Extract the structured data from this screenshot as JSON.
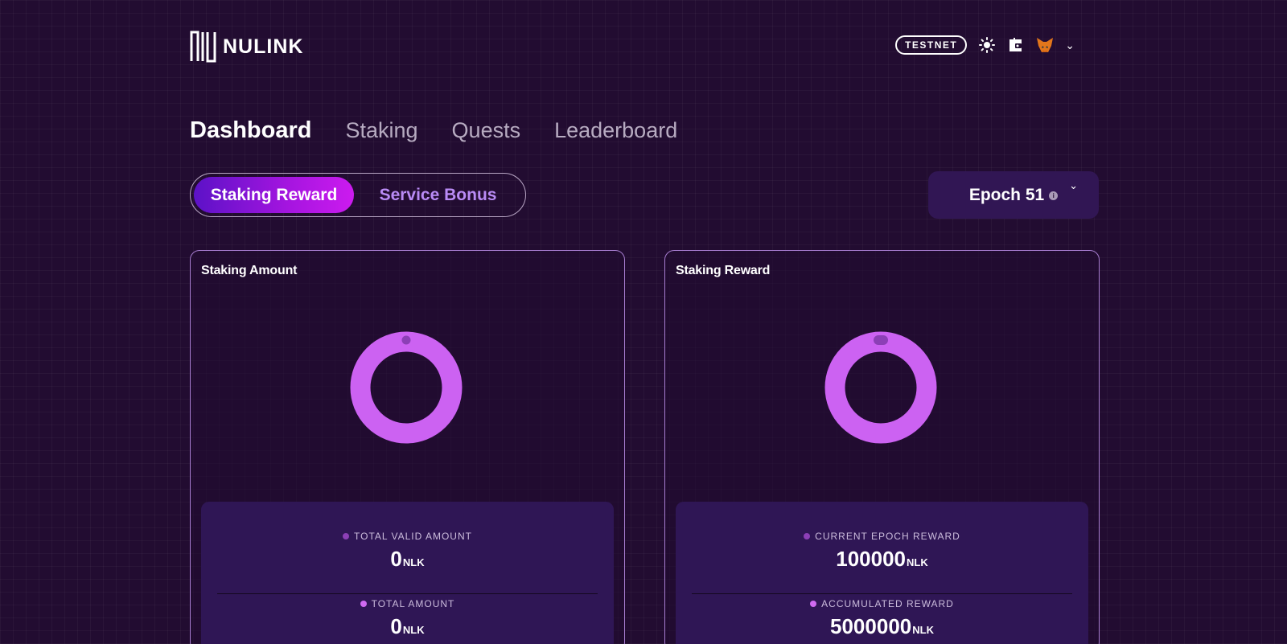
{
  "header": {
    "logo_text": "NULINK",
    "network_badge": "TESTNET",
    "icons": [
      "sun-icon",
      "wallet-icon",
      "metamask-fox-icon",
      "chevron-down-icon"
    ]
  },
  "nav": {
    "tabs": [
      {
        "label": "Dashboard",
        "active": true
      },
      {
        "label": "Staking",
        "active": false
      },
      {
        "label": "Quests",
        "active": false
      },
      {
        "label": "Leaderboard",
        "active": false
      }
    ]
  },
  "toggle": {
    "active": "Staking Reward",
    "inactive": "Service Bonus"
  },
  "epoch": {
    "label": "Epoch 51",
    "info": "i"
  },
  "cards": {
    "staking_amount": {
      "title": "Staking Amount",
      "stat1": {
        "label": "TOTAL VALID AMOUNT",
        "value": "0",
        "unit": "NLK"
      },
      "stat2": {
        "label": "TOTAL AMOUNT",
        "value": "0",
        "unit": "NLK"
      }
    },
    "staking_reward": {
      "title": "Staking Reward",
      "stat1": {
        "label": "CURRENT EPOCH REWARD",
        "value": "100000",
        "unit": "NLK"
      },
      "stat2": {
        "label": "ACCUMULATED REWARD",
        "value": "5000000",
        "unit": "NLK"
      }
    }
  },
  "colors": {
    "background": "#220c31",
    "accent_purple": "#cc62f2",
    "toggle_gradient_start": "#5c12c7",
    "toggle_gradient_end": "#cc1bef",
    "panel": "#2f1655"
  }
}
